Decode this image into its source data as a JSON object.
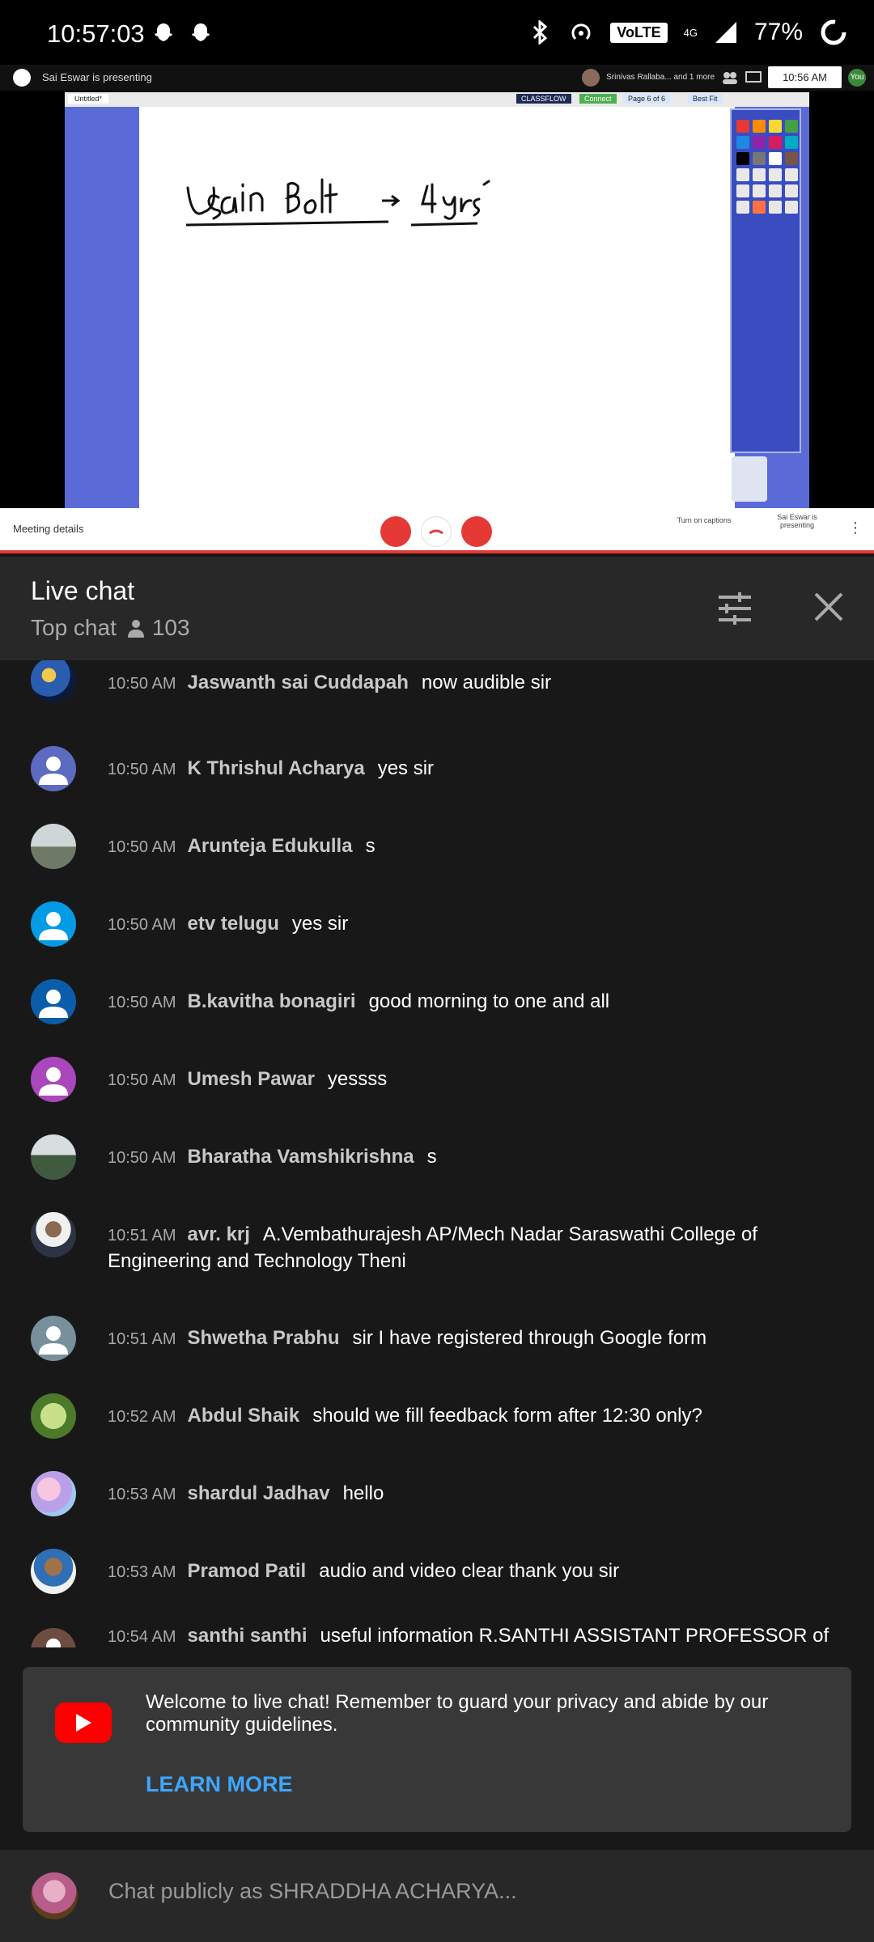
{
  "status_bar": {
    "time": "10:57:03",
    "network": "4G",
    "volte": "VoLTE",
    "battery": "77%"
  },
  "meeting": {
    "presenting_text": "Sai Eswar is presenting",
    "participants_text": "Srinivas Rallaba... and 1 more",
    "clock": "10:56 AM",
    "you_label": "You",
    "share_tab": "Untitled*",
    "classflow": "CLASSFLOW",
    "connect": "Connect",
    "page": "Page 6 of 6",
    "fit": "Best Fit",
    "details": "Meeting details",
    "captions": "Turn on captions",
    "presenting_footer": "Sai Eswar is presenting"
  },
  "chat": {
    "title": "Live chat",
    "mode": "Top chat",
    "viewers": "103"
  },
  "messages": [
    {
      "time": "10:50 AM",
      "author": "Jaswanth sai Cuddapah",
      "text": "now audible sir",
      "avatar": "photo-blue"
    },
    {
      "time": "10:50 AM",
      "author": "K Thrishul Acharya",
      "text": "yes sir",
      "avatar": "default-indigo"
    },
    {
      "time": "10:50 AM",
      "author": "Arunteja Edukulla",
      "text": "s",
      "avatar": "photo-grey"
    },
    {
      "time": "10:50 AM",
      "author": "etv telugu",
      "text": "yes sir",
      "avatar": "default-blue"
    },
    {
      "time": "10:50 AM",
      "author": "B.kavitha bonagiri",
      "text": "good morning to one and all",
      "avatar": "default-darkblue"
    },
    {
      "time": "10:50 AM",
      "author": "Umesh Pawar",
      "text": "yessss",
      "avatar": "default-purple"
    },
    {
      "time": "10:50 AM",
      "author": "Bharatha Vamshikrishna",
      "text": "s",
      "avatar": "photo-green"
    },
    {
      "time": "10:51 AM",
      "author": "avr. krj",
      "text": "A.Vembathurajesh AP/Mech Nadar Saraswathi College of Engineering and Technology Theni",
      "avatar": "photo-man"
    },
    {
      "time": "10:51 AM",
      "author": "Shwetha Prabhu",
      "text": "sir I have registered through Google form",
      "avatar": "default-grey"
    },
    {
      "time": "10:52 AM",
      "author": "Abdul Shaik",
      "text": "should we fill feedback form after 12:30 only?",
      "avatar": "photo-allah"
    },
    {
      "time": "10:53 AM",
      "author": "shardul Jadhav",
      "text": "hello",
      "avatar": "photo-pink"
    },
    {
      "time": "10:53 AM",
      "author": "Pramod Patil",
      "text": "audio and video clear thank you sir",
      "avatar": "photo-pramod"
    },
    {
      "time": "10:54 AM",
      "author": "santhi santhi",
      "text": "useful information R.SANTHI ASSISTANT PROFESSOR of HISTORY, A.V.C COLLEGE AUTONOMOUS MANNAMPANDAL MAYILADUTHURAI",
      "avatar": "default-brown"
    }
  ],
  "welcome": {
    "text": "Welcome to live chat! Remember to guard your privacy and abide by our community guidelines.",
    "learn_more": "LEARN MORE"
  },
  "input": {
    "placeholder": "Chat publicly as SHRADDHA ACHARYA..."
  },
  "colors": {
    "accent_link": "#3ea6ff",
    "youtube_red": "#ff0000",
    "panel_bg": "#282828",
    "chat_bg": "#181818"
  }
}
